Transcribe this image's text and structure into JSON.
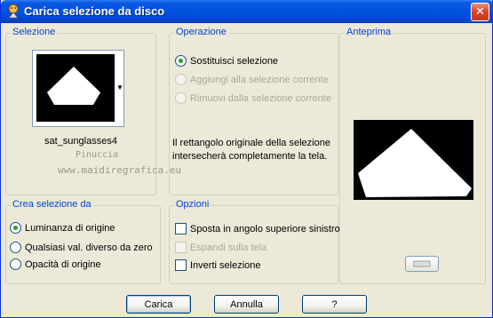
{
  "window": {
    "title": "Carica selezione da disco",
    "close_glyph": "✕"
  },
  "selection_group": {
    "title": "Selezione",
    "selected_name": "sat_sunglasses4",
    "combo_arrow": "▼",
    "watermark_line1": "Pinuccia",
    "watermark_line2": "www.maidiregrafica.eu"
  },
  "operation_group": {
    "title": "Operazione",
    "options": [
      {
        "label": "Sostituisci selezione",
        "checked": true,
        "disabled": false
      },
      {
        "label": "Aggiungi alla selezione corrente",
        "checked": false,
        "disabled": true
      },
      {
        "label": "Rimuovi dalla selezione corrente",
        "checked": false,
        "disabled": true
      }
    ],
    "description_line1": "Il rettangolo originale della selezione",
    "description_line2": "intersecherà completamente la tela."
  },
  "preview_group": {
    "title": "Anteprima"
  },
  "create_group": {
    "title": "Crea selezione da",
    "options": [
      {
        "label": "Luminanza di origine",
        "checked": true
      },
      {
        "label": "Qualsiasi val. diverso da zero",
        "checked": false
      },
      {
        "label": "Opacità di origine",
        "checked": false
      }
    ]
  },
  "options_group": {
    "title": "Opzioni",
    "items": [
      {
        "label": "Sposta in angolo superiore sinistro",
        "checked": false,
        "disabled": false
      },
      {
        "label": "Espandi sulla tela",
        "checked": false,
        "disabled": true
      },
      {
        "label": "Inverti selezione",
        "checked": false,
        "disabled": false
      }
    ]
  },
  "buttons": {
    "load": "Carica",
    "cancel": "Annulla",
    "help": "?"
  },
  "icons": {
    "app": "paint-shop-pro-icon",
    "close": "close-icon",
    "combo": "chevron-down-icon",
    "preview_toggle": "preview-toggle-icon"
  },
  "colors": {
    "title_bar": "#0052e0",
    "group_title": "#0046d5",
    "window_bg": "#ece9d8"
  }
}
